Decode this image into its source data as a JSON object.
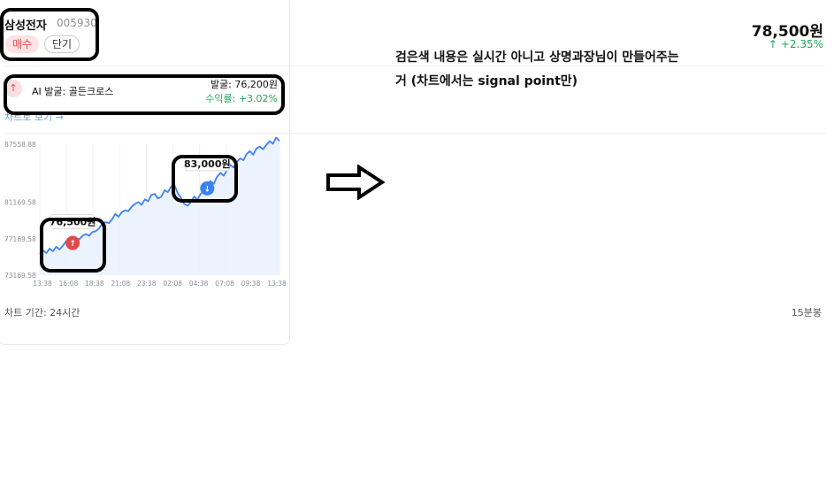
{
  "stock": {
    "name": "삼성전자",
    "code": "005930",
    "badge_buy": "매수",
    "badge_term": "단기",
    "price": "78,500원",
    "change": "+2.35%",
    "change_arrow": "↑"
  },
  "signal": {
    "icon": "arrow-up-icon",
    "icon_glyph": "↑",
    "label": "AI 발굴: 골든크로스",
    "price": "발굴: 76,200원",
    "return": "수익률: +3.02%"
  },
  "chart_link": "차트로 보기 →",
  "chart_data": {
    "type": "area",
    "y_ticks": [
      "87558.88",
      "81169.58",
      "77169.58",
      "73169.58"
    ],
    "x_ticks": [
      "13:38",
      "16:08",
      "18:38",
      "21:08",
      "23:38",
      "02:08",
      "04:38",
      "07:08",
      "09:38",
      "13:38"
    ],
    "values": [
      75500,
      75900,
      75600,
      76100,
      75800,
      76300,
      76000,
      76400,
      76900,
      76500,
      77200,
      77300,
      77100,
      77500,
      77700,
      77500,
      77900,
      78000,
      78300,
      78800,
      79000,
      78900,
      79300,
      79900,
      79600,
      80100,
      80300,
      80200,
      80700,
      81000,
      81200,
      80900,
      81500,
      81300,
      82000,
      82100,
      81600,
      81800,
      82500,
      82300,
      82900,
      83100,
      82200,
      81700,
      81000,
      80800,
      81200,
      81800,
      81500,
      82100,
      82400,
      83000,
      83500,
      83200,
      84000,
      84400,
      84100,
      84700,
      85300,
      85000,
      85600,
      86000,
      85800,
      86500,
      86800,
      86400,
      87100,
      87300,
      87000,
      87500,
      87900,
      87600,
      88300,
      87900
    ],
    "ylim": [
      73169.58,
      87558.88
    ],
    "markers": [
      {
        "type": "buy",
        "index": 10,
        "label": "76,500원",
        "icon": "arrow-up-icon"
      },
      {
        "type": "sell",
        "index": 51,
        "label": "83,000원",
        "icon": "arrow-down-icon"
      }
    ],
    "line_color": "#3b82f6",
    "fill_color": "#e8f0fe",
    "grid": true
  },
  "footer": {
    "period": "차트 기간: 24시간",
    "interval": "15분봉"
  },
  "note": {
    "line1": "검은색 내용은 실시간 아니고 상명과장님이 만들어주는",
    "line2": "거 (차트에서는 signal point만)"
  },
  "colors": {
    "up": "#e24a4a",
    "positive": "#23a55a",
    "sell": "#3b82f6",
    "link": "#6f9ee0"
  }
}
